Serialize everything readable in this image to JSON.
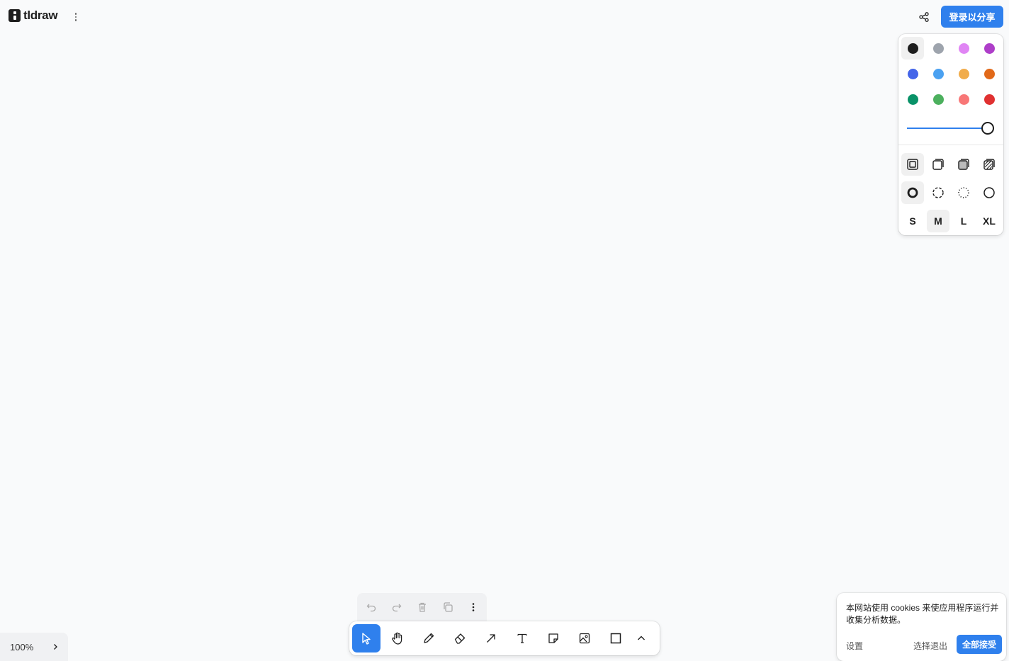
{
  "app": {
    "name": "tldraw"
  },
  "header": {
    "login_button": "登录以分享"
  },
  "style_panel": {
    "colors": [
      {
        "name": "black",
        "hex": "#1d1d1d",
        "selected": true
      },
      {
        "name": "grey",
        "hex": "#9ea4ad"
      },
      {
        "name": "light-violet",
        "hex": "#e085f4"
      },
      {
        "name": "violet",
        "hex": "#ae3ec9"
      },
      {
        "name": "blue",
        "hex": "#4465e9"
      },
      {
        "name": "light-blue",
        "hex": "#4ba1f1"
      },
      {
        "name": "yellow",
        "hex": "#f1ac4b"
      },
      {
        "name": "orange",
        "hex": "#e16919"
      },
      {
        "name": "green",
        "hex": "#099268"
      },
      {
        "name": "light-green",
        "hex": "#4cb05e"
      },
      {
        "name": "light-red",
        "hex": "#f87777"
      },
      {
        "name": "red",
        "hex": "#e03131"
      }
    ],
    "opacity": 1.0,
    "fill_options": [
      "fill-none-icon",
      "fill-semi-icon",
      "fill-solid-icon",
      "fill-pattern-icon"
    ],
    "dash_options": [
      "dash-draw-icon",
      "dash-dashed-icon",
      "dash-dotted-icon",
      "dash-solid-icon"
    ],
    "sizes": [
      {
        "label": "S"
      },
      {
        "label": "M",
        "selected": true
      },
      {
        "label": "L"
      },
      {
        "label": "XL"
      }
    ]
  },
  "zoom": {
    "label": "100%"
  },
  "toolbar": {
    "tools": [
      "select",
      "hand",
      "draw",
      "eraser",
      "arrow",
      "text",
      "note",
      "asset",
      "rectangle",
      "more"
    ],
    "active": "select"
  },
  "cookie": {
    "message": "本网站使用 cookies 来使应用程序运行并收集分析数据。",
    "settings": "设置",
    "reject": "选择退出",
    "accept": "全部接受"
  },
  "accent_color": "#2f80ed"
}
